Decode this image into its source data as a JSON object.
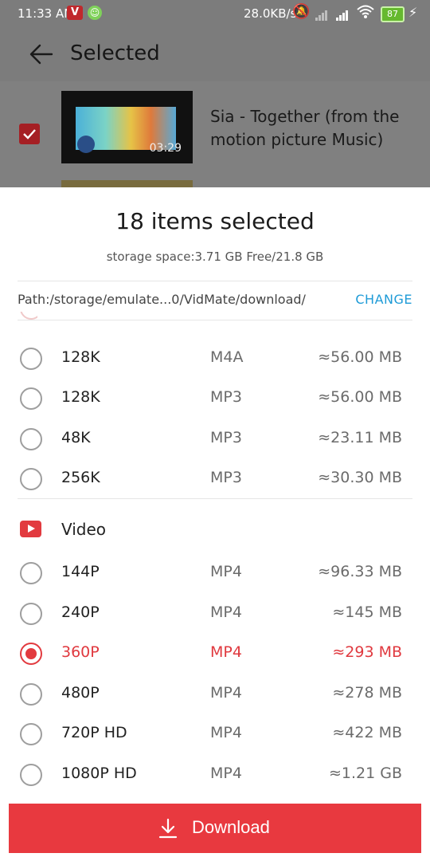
{
  "status_bar": {
    "time": "11:33 AM",
    "network_speed": "28.0KB/s",
    "battery": "87",
    "colors": {
      "badge": "#c0282c",
      "battery": "#66b92f"
    }
  },
  "app_header": {
    "title": "Selected"
  },
  "background_list": {
    "items": [
      {
        "title": "Sia - Together (from the motion picture Music)",
        "duration": "03:29",
        "checked": true
      }
    ]
  },
  "sheet": {
    "title": "18 items selected",
    "storage": "storage space:3.71 GB Free/21.8 GB",
    "path": "Path:/storage/emulate...0/VidMate/download/",
    "change_label": "CHANGE",
    "audio_options": [
      {
        "quality": "128K",
        "format": "M4A",
        "size": "≈56.00 MB",
        "selected": false
      },
      {
        "quality": "128K",
        "format": "MP3",
        "size": "≈56.00 MB",
        "selected": false
      },
      {
        "quality": "48K",
        "format": "MP3",
        "size": "≈23.11 MB",
        "selected": false
      },
      {
        "quality": "256K",
        "format": "MP3",
        "size": "≈30.30 MB",
        "selected": false
      }
    ],
    "video_section_label": "Video",
    "video_options": [
      {
        "quality": "144P",
        "format": "MP4",
        "size": "≈96.33 MB",
        "selected": false
      },
      {
        "quality": "240P",
        "format": "MP4",
        "size": "≈145 MB",
        "selected": false
      },
      {
        "quality": "360P",
        "format": "MP4",
        "size": "≈293 MB",
        "selected": true
      },
      {
        "quality": "480P",
        "format": "MP4",
        "size": "≈278 MB",
        "selected": false
      },
      {
        "quality": "720P HD",
        "format": "MP4",
        "size": "≈422 MB",
        "selected": false
      },
      {
        "quality": "1080P HD",
        "format": "MP4",
        "size": "≈1.21 GB",
        "selected": false
      }
    ],
    "download_label": "Download",
    "colors": {
      "accent": "#e8393f",
      "link": "#1e9bd7"
    }
  }
}
